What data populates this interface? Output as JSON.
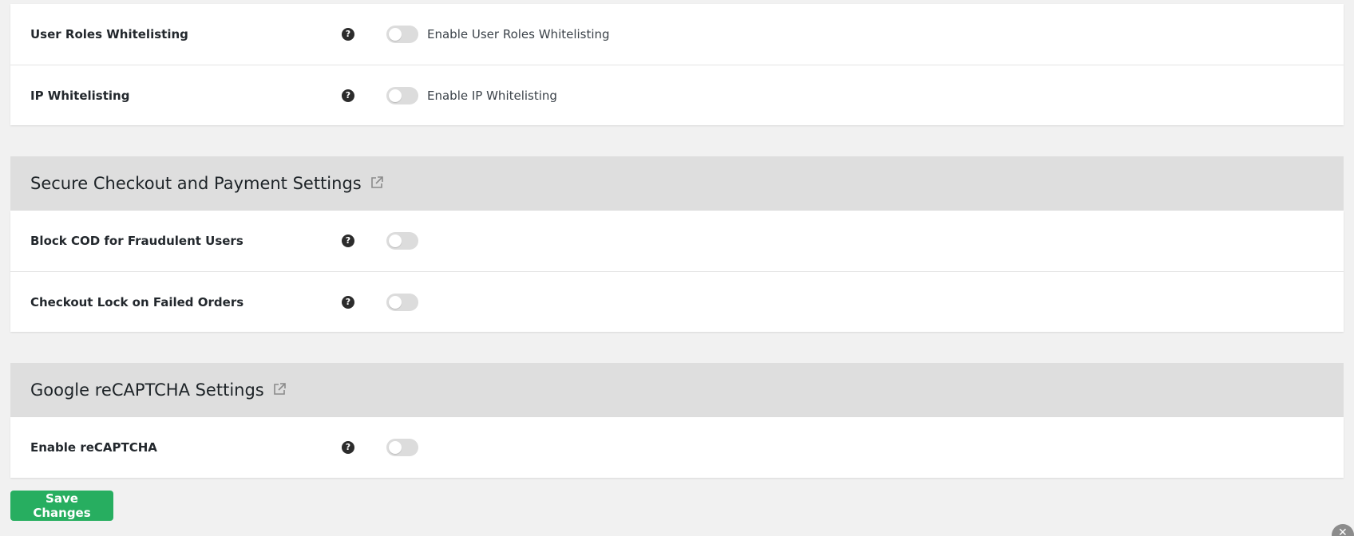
{
  "whitelisting_card": {
    "rows": [
      {
        "label": "User Roles Whitelisting",
        "toggle_text": "Enable User Roles Whitelisting",
        "enabled": false
      },
      {
        "label": "IP Whitelisting",
        "toggle_text": "Enable IP Whitelisting",
        "enabled": false
      }
    ]
  },
  "checkout_section": {
    "title": "Secure Checkout and Payment Settings",
    "rows": [
      {
        "label": "Block COD for Fraudulent Users",
        "enabled": false
      },
      {
        "label": "Checkout Lock on Failed Orders",
        "enabled": false
      }
    ]
  },
  "recaptcha_section": {
    "title": "Google reCAPTCHA Settings",
    "rows": [
      {
        "label": "Enable reCAPTCHA",
        "enabled": false
      }
    ]
  },
  "help_glyph": "?",
  "close_glyph": "✕",
  "save_button": {
    "label": "Save Changes"
  },
  "colors": {
    "accent_green": "#27ae60",
    "toggle_off": "#dcdcdc",
    "section_header_bg": "#dedede",
    "page_bg": "#f1f1f1"
  }
}
